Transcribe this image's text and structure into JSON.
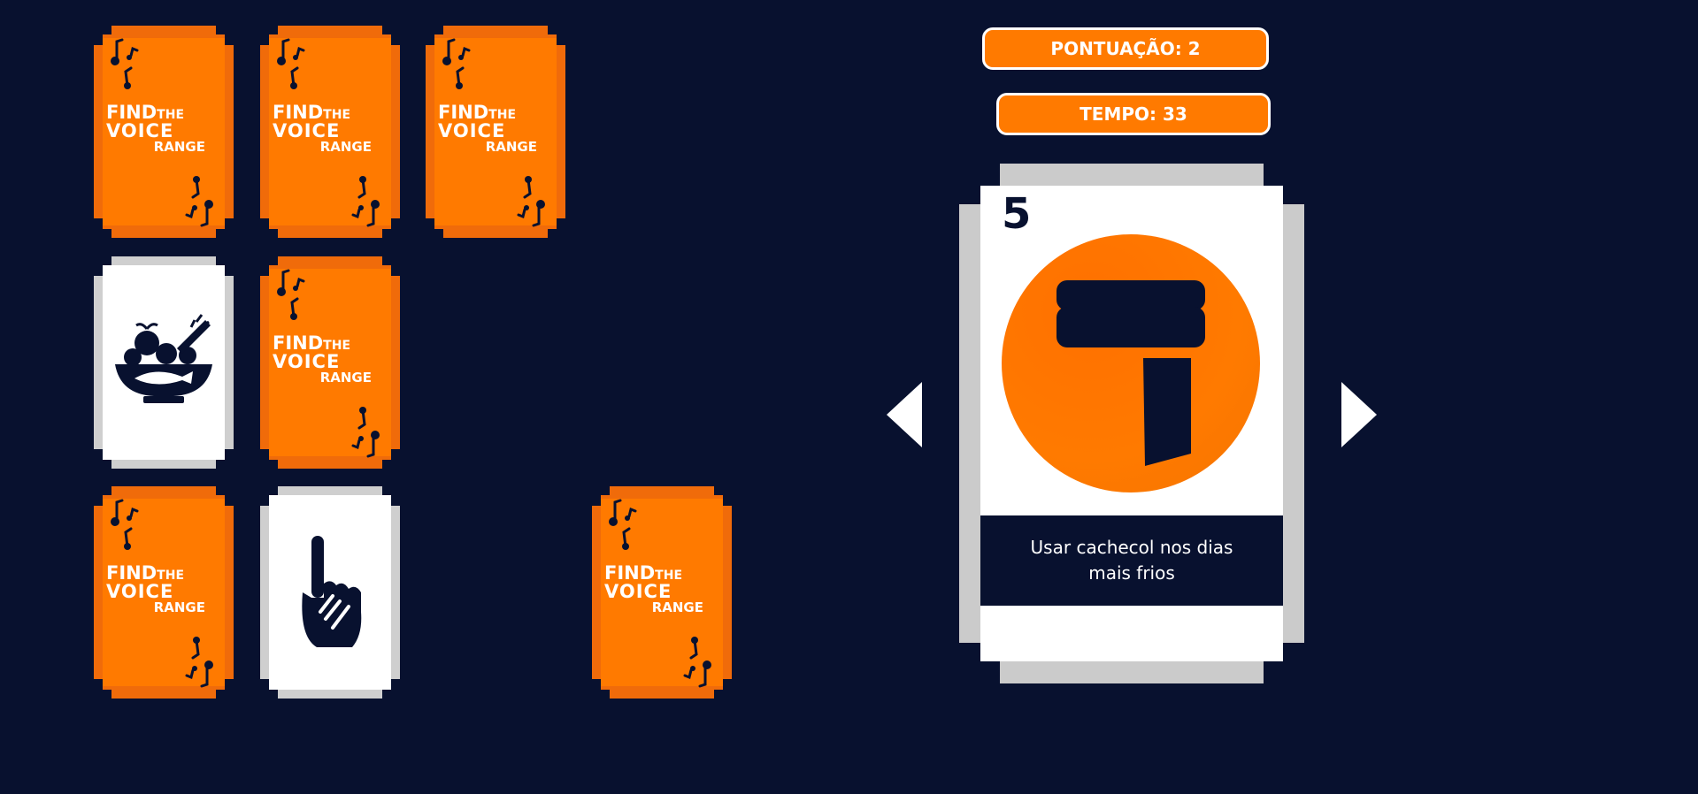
{
  "game": {
    "logo": {
      "find": "FIND",
      "the": "THE",
      "voice": "VOICE",
      "range": "RANGE"
    },
    "score": {
      "label": "PONTUAÇÃO: 2"
    },
    "timer": {
      "label": "TEMPO: 33"
    },
    "board": {
      "cards": [
        {
          "state": "face-down"
        },
        {
          "state": "face-down"
        },
        {
          "state": "face-down"
        },
        {
          "state": "face-up",
          "icon": "food-bowl-icon"
        },
        {
          "state": "face-down"
        },
        {
          "state": "face-down"
        },
        {
          "state": "face-up",
          "icon": "hand-pointing-icon"
        },
        {
          "state": "face-down"
        }
      ]
    },
    "detail_card": {
      "number": "5",
      "icon": "scarf-icon",
      "caption": "Usar cachecol nos dias mais frios"
    },
    "nav": {
      "prev_icon": "arrow-left-icon",
      "next_icon": "arrow-right-icon"
    }
  },
  "colors": {
    "background": "#08112f",
    "accent": "#ff7a00",
    "card_border": "#cfcfcf",
    "white": "#ffffff"
  }
}
